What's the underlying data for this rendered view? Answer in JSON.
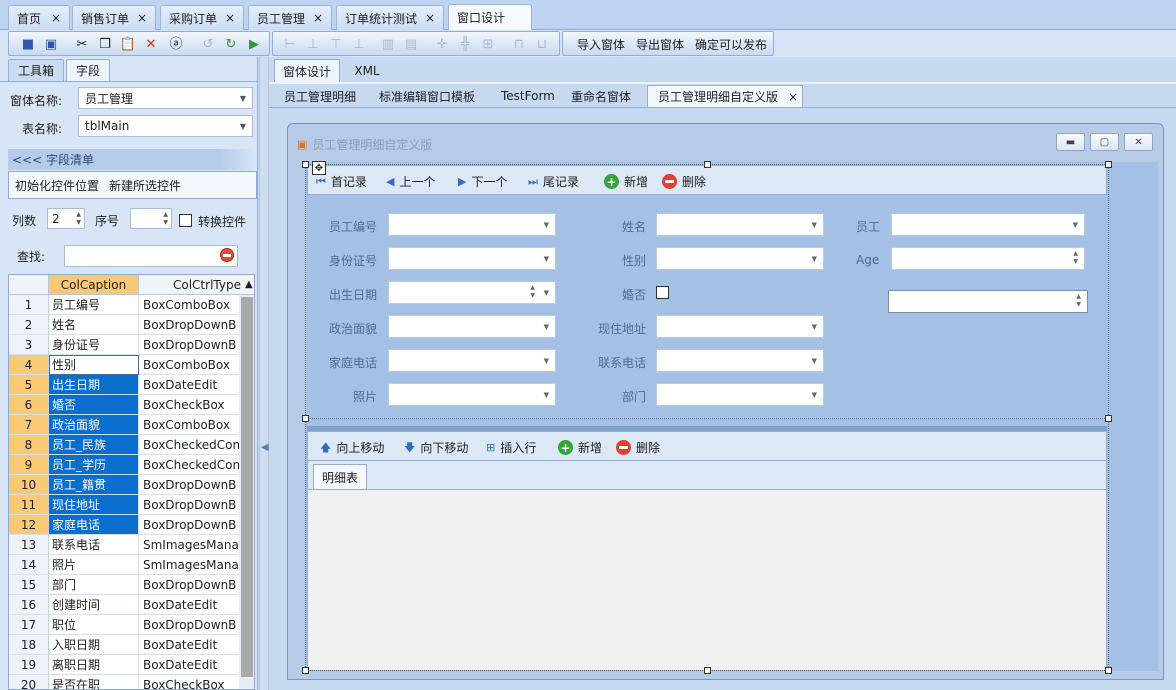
{
  "doc_tabs": [
    {
      "label": "首页",
      "active": false
    },
    {
      "label": "销售订单",
      "active": false
    },
    {
      "label": "采购订单",
      "active": false
    },
    {
      "label": "员工管理",
      "active": false
    },
    {
      "label": "订单统计测试",
      "active": false
    },
    {
      "label": "窗口设计",
      "active": true
    }
  ],
  "tab_close": "×",
  "toolbar": {
    "import_form": "导入窗体",
    "export_form": "导出窗体",
    "confirm_publish": "确定可以发布"
  },
  "left": {
    "tab_toolbox": "工具箱",
    "tab_fields": "字段",
    "form_name_label": "窗体名称:",
    "form_name_value": "员工管理",
    "table_name_label": "表名称:",
    "table_name_value": "tblMain",
    "field_list_title": "<<< 字段清单",
    "init_positions": "初始化控件位置",
    "new_selected": "新建所选控件",
    "columns_label": "列数",
    "columns_value": "2",
    "seq_label": "序号",
    "seq_value": "",
    "convert_label": "转换控件",
    "search_label": "查找:",
    "search_value": "",
    "grid_headers": [
      "ColCaption",
      "ColCtrlType"
    ],
    "grid_rows": [
      {
        "n": "1",
        "cap": "员工编号",
        "type": "BoxComboBox"
      },
      {
        "n": "2",
        "cap": "姓名",
        "type": "BoxDropDownB"
      },
      {
        "n": "3",
        "cap": "身份证号",
        "type": "BoxDropDownB"
      },
      {
        "n": "4",
        "cap": "性别",
        "type": "BoxComboBox"
      },
      {
        "n": "5",
        "cap": "出生日期",
        "type": "BoxDateEdit"
      },
      {
        "n": "6",
        "cap": "婚否",
        "type": "BoxCheckBox"
      },
      {
        "n": "7",
        "cap": "政治面貌",
        "type": "BoxComboBox"
      },
      {
        "n": "8",
        "cap": "员工_民族",
        "type": "BoxCheckedCon"
      },
      {
        "n": "9",
        "cap": "员工_学历",
        "type": "BoxCheckedCon"
      },
      {
        "n": "10",
        "cap": "员工_籍贯",
        "type": "BoxDropDownB"
      },
      {
        "n": "11",
        "cap": "现住地址",
        "type": "BoxDropDownB"
      },
      {
        "n": "12",
        "cap": "家庭电话",
        "type": "BoxDropDownB"
      },
      {
        "n": "13",
        "cap": "联系电话",
        "type": "SmImagesMana"
      },
      {
        "n": "14",
        "cap": "照片",
        "type": "SmImagesMana"
      },
      {
        "n": "15",
        "cap": "部门",
        "type": "BoxDropDownB"
      },
      {
        "n": "16",
        "cap": "创建时间",
        "type": "BoxDateEdit"
      },
      {
        "n": "17",
        "cap": "职位",
        "type": "BoxDropDownB"
      },
      {
        "n": "18",
        "cap": "入职日期",
        "type": "BoxDateEdit"
      },
      {
        "n": "19",
        "cap": "离职日期",
        "type": "BoxDateEdit"
      },
      {
        "n": "20",
        "cap": "是否在职",
        "type": "BoxCheckBox"
      }
    ]
  },
  "right": {
    "tab_design": "窗体设计",
    "tab_xml": "XML",
    "form_tabs": [
      {
        "label": "员工管理明细",
        "active": false
      },
      {
        "label": "标准编辑窗口模板",
        "active": false
      },
      {
        "label": "TestForm",
        "active": false
      },
      {
        "label": "重命名窗体",
        "active": false
      },
      {
        "label": "员工管理明细自定义版",
        "active": true
      }
    ],
    "window_title": "员工管理明细自定义版",
    "nav": {
      "first": "首记录",
      "prev": "上一个",
      "next": "下一个",
      "last": "尾记录",
      "add": "新增",
      "delete": "删除"
    },
    "fields": {
      "emp_no": "员工编号",
      "name": "姓名",
      "employee": "员工",
      "id_card": "身份证号",
      "gender": "性别",
      "age": "Age",
      "birth": "出生日期",
      "married": "婚否",
      "politics": "政治面貌",
      "address": "现住地址",
      "home_phone": "家庭电话",
      "phone": "联系电话",
      "photo": "照片",
      "dept": "部门"
    },
    "detail_toolbar": {
      "move_up": "向上移动",
      "move_down": "向下移动",
      "insert_row": "插入行",
      "add": "新增",
      "delete": "删除"
    },
    "detail_tab": "明细表"
  }
}
